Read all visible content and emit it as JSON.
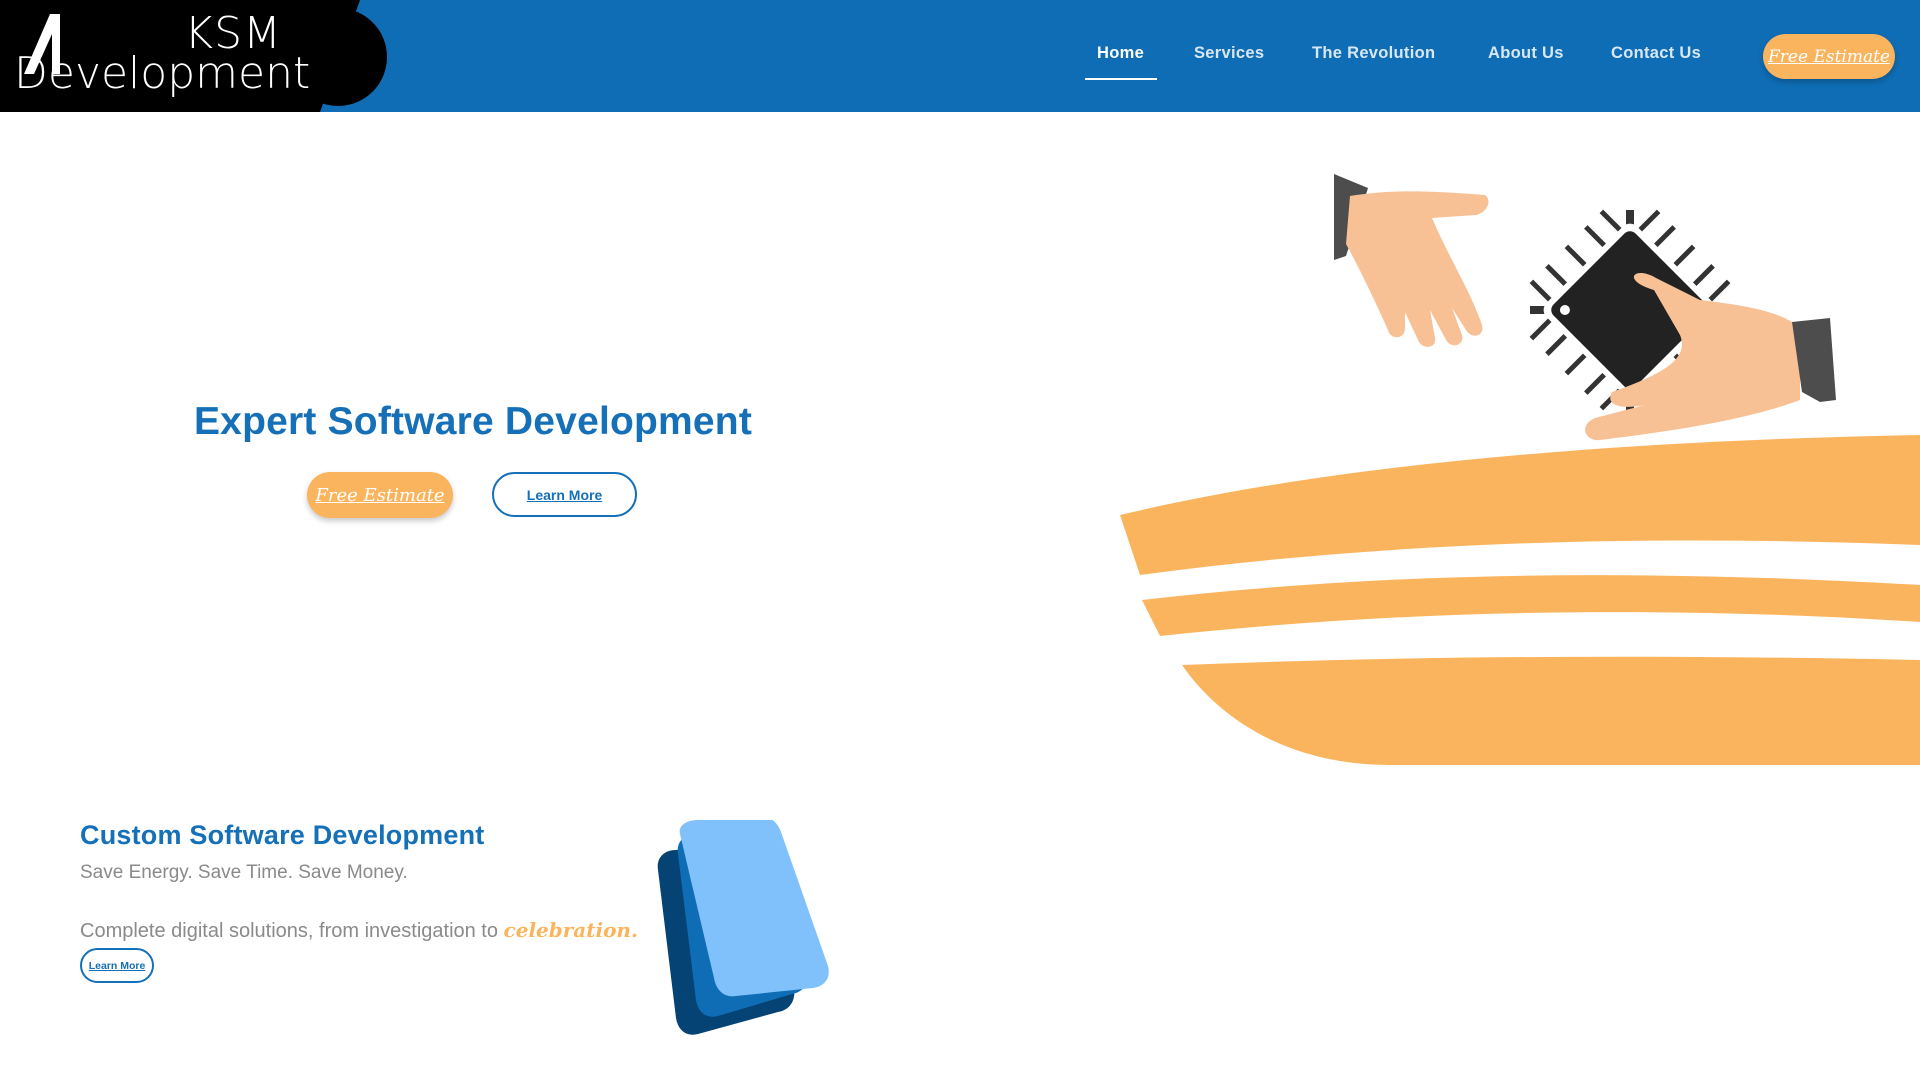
{
  "brand": {
    "line1": "KSM",
    "line2": "Development",
    "colors": {
      "primary": "#0f6db5",
      "accent": "#fbb45e",
      "dark": "#000000"
    }
  },
  "nav": {
    "items": [
      {
        "label": "Home",
        "active": true
      },
      {
        "label": "Services",
        "active": false
      },
      {
        "label": "The Revolution",
        "active": false
      },
      {
        "label": "About Us",
        "active": false
      },
      {
        "label": "Contact Us",
        "active": false
      }
    ],
    "cta_label": "Free Estimate"
  },
  "hero": {
    "title": "Expert Software Development",
    "cta_label": "Free Estimate",
    "learn_label": "Learn More",
    "illustration_icon": "handshake-chip-icon"
  },
  "section": {
    "title": "Custom Software Development",
    "subtitle": "Save Energy. Save Time. Save Money.",
    "desc_prefix": "Complete digital solutions, from investigation to ",
    "desc_accent": "celebration.",
    "learn_label": "Learn More",
    "illustration_icon": "stacked-cards-icon"
  }
}
